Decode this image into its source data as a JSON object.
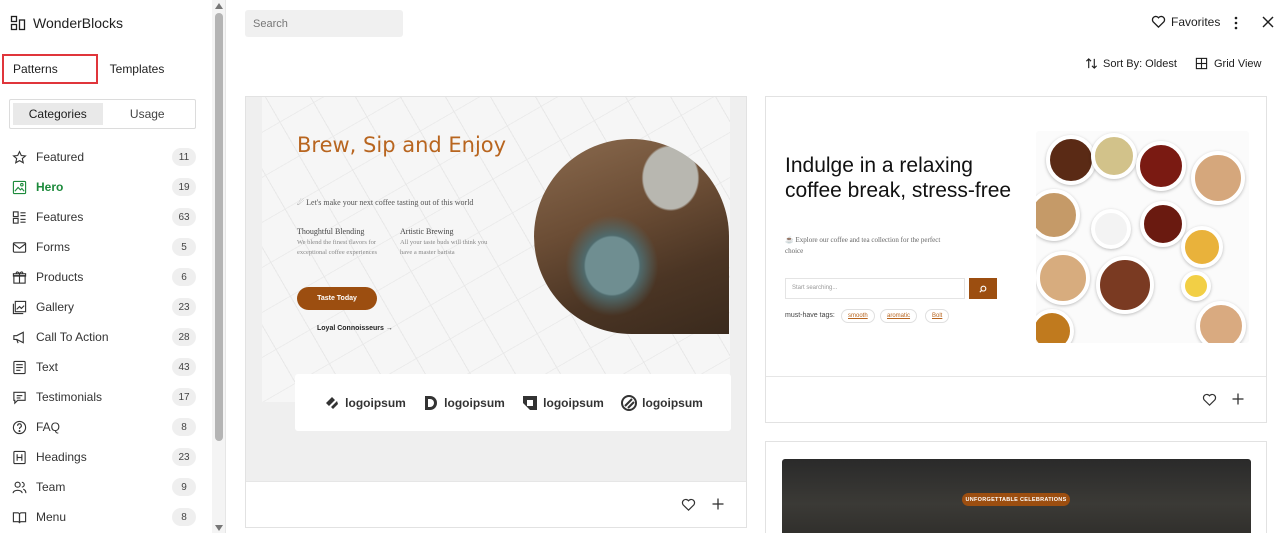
{
  "brand": {
    "name": "WonderBlocks"
  },
  "tabs": {
    "patterns": "Patterns",
    "templates": "Templates"
  },
  "segment": {
    "categories": "Categories",
    "usage": "Usage"
  },
  "categories": [
    {
      "label": "Featured",
      "count": "11",
      "icon": "star-icon"
    },
    {
      "label": "Hero",
      "count": "19",
      "icon": "image-icon",
      "active": true
    },
    {
      "label": "Features",
      "count": "63",
      "icon": "features-icon"
    },
    {
      "label": "Forms",
      "count": "5",
      "icon": "mail-icon"
    },
    {
      "label": "Products",
      "count": "6",
      "icon": "gift-icon"
    },
    {
      "label": "Gallery",
      "count": "23",
      "icon": "gallery-icon"
    },
    {
      "label": "Call To Action",
      "count": "28",
      "icon": "megaphone-icon"
    },
    {
      "label": "Text",
      "count": "43",
      "icon": "text-icon"
    },
    {
      "label": "Testimonials",
      "count": "17",
      "icon": "quote-icon"
    },
    {
      "label": "FAQ",
      "count": "8",
      "icon": "help-icon"
    },
    {
      "label": "Headings",
      "count": "23",
      "icon": "heading-icon"
    },
    {
      "label": "Team",
      "count": "9",
      "icon": "team-icon"
    },
    {
      "label": "Menu",
      "count": "8",
      "icon": "book-icon"
    }
  ],
  "toolbar": {
    "search_placeholder": "Search",
    "favorites": "Favorites",
    "sort": "Sort By: Oldest",
    "view": "Grid View"
  },
  "card1": {
    "title": "Brew, Sip and Enjoy",
    "subtitle": "Let's make your next coffee tasting out of this world",
    "feature1_title": "Thoughtful Blending",
    "feature1_desc": "We blend the finest flavors for exceptional coffee experiences",
    "feature2_title": "Artistic Brewing",
    "feature2_desc": "All your taste buds will think you have a master barista",
    "cta": "Taste Today",
    "link": "Loyal Connoisseurs →",
    "logo_text": "logoipsum"
  },
  "card2": {
    "title": "Indulge in a relaxing coffee break, stress-free",
    "subtitle": "Explore our coffee and tea collection for the perfect choice",
    "search_placeholder": "Start searching...",
    "tags_label": "must-have tags:",
    "tags": [
      "smooth",
      "aromatic",
      "Bolt"
    ]
  },
  "card3": {
    "badge": "UNFORGETTABLE CELEBRATIONS"
  },
  "colors": {
    "accent": "#1c8a3b",
    "brown": "#9c4e10",
    "highlight": "#e0353b"
  }
}
